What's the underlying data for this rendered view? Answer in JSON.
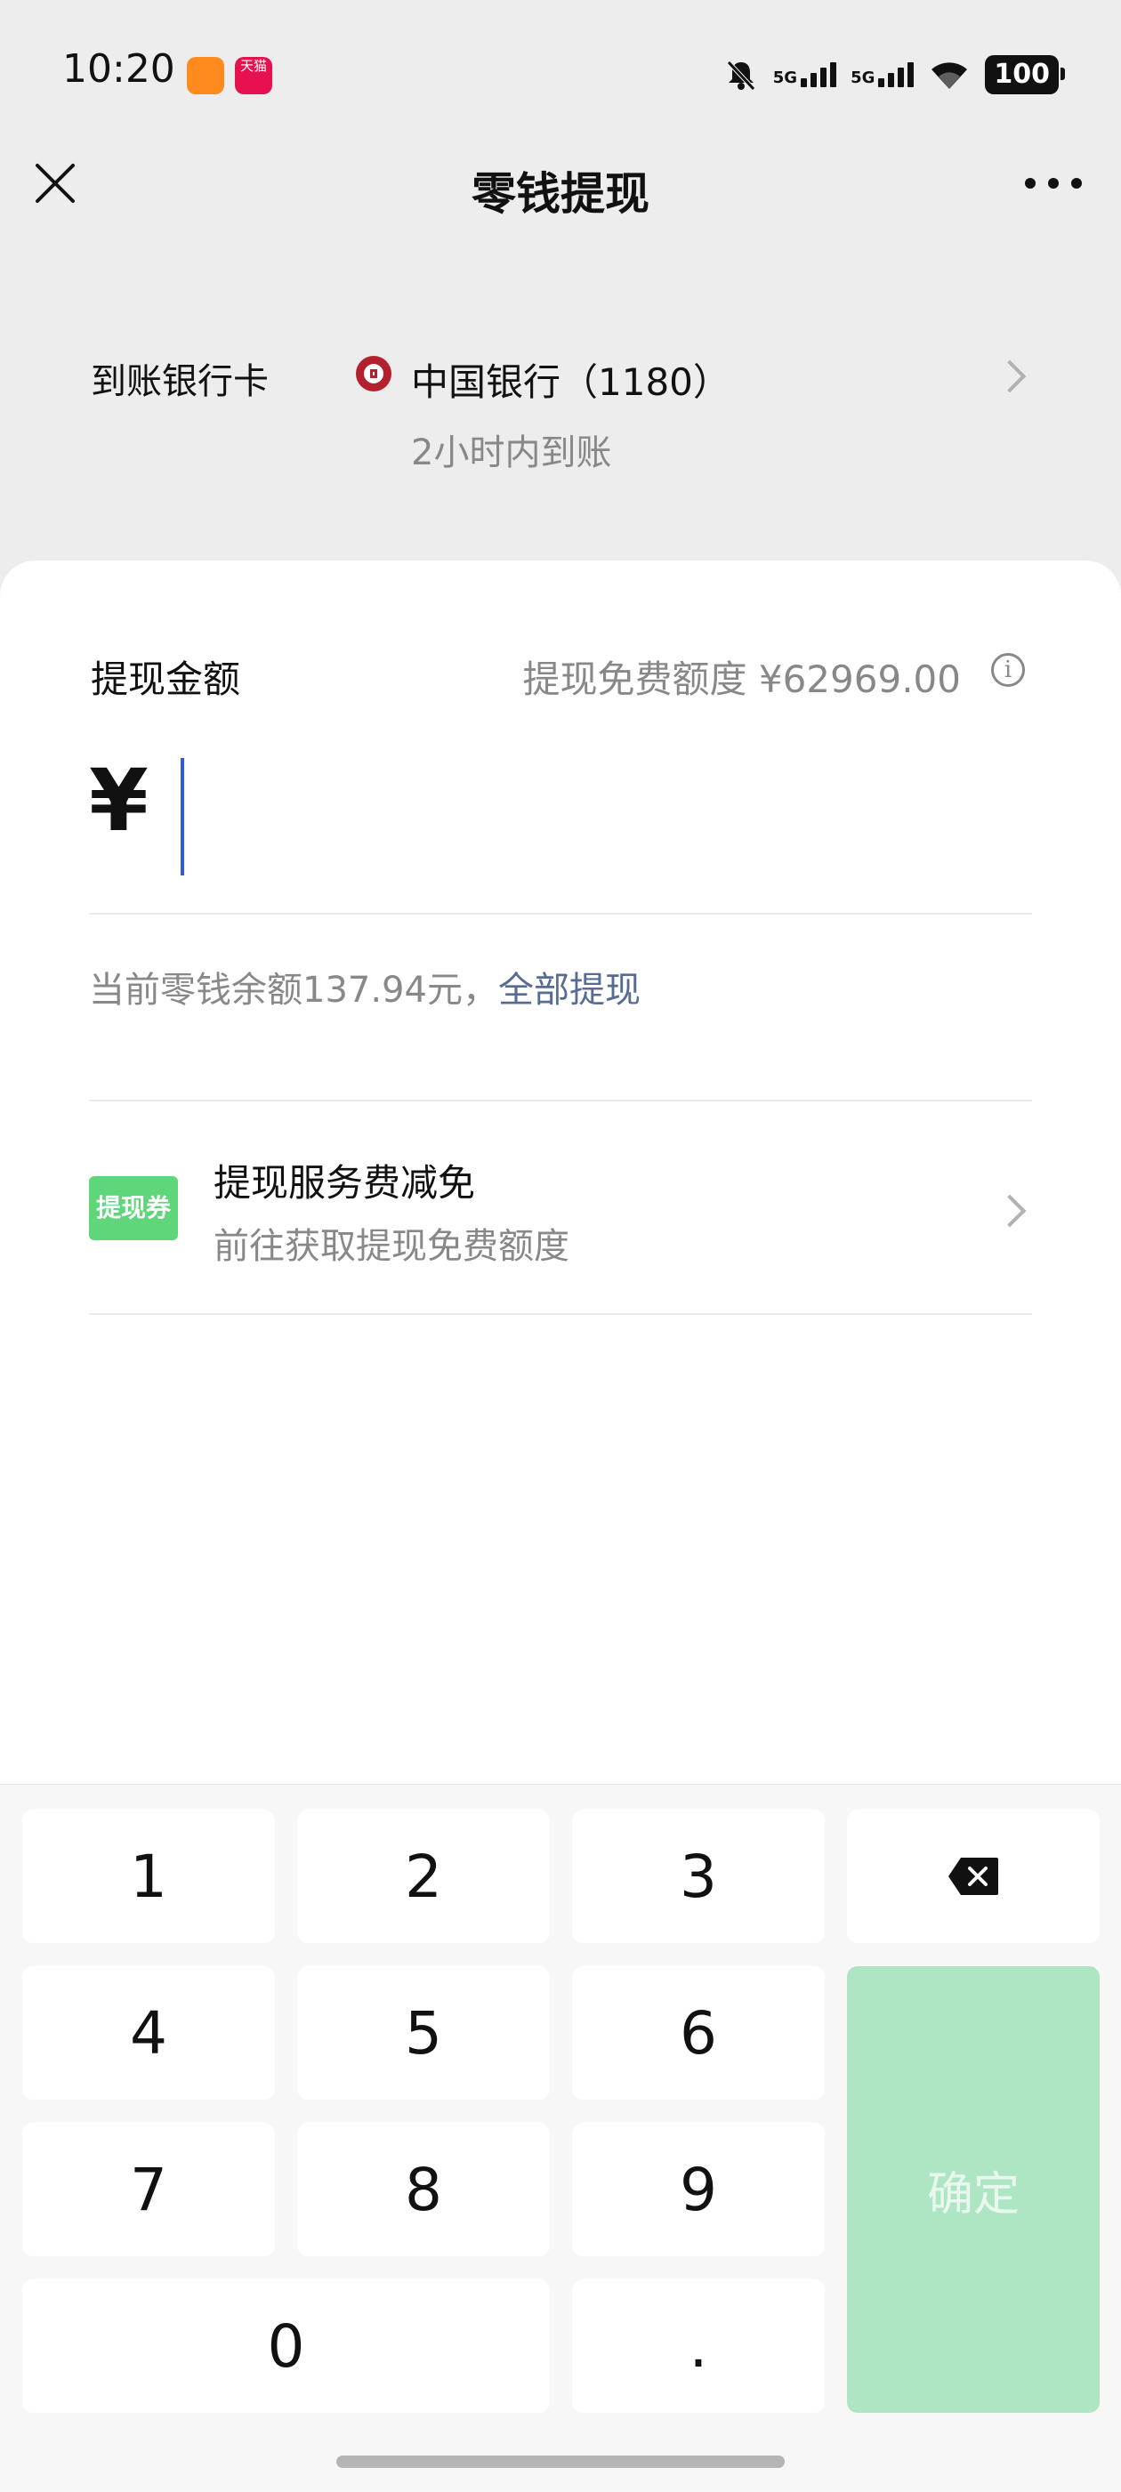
{
  "status_bar": {
    "time": "10:20",
    "tmall_label": "天猫",
    "network": [
      "5G",
      "5G"
    ],
    "battery": "100"
  },
  "nav": {
    "title": "零钱提现"
  },
  "bank": {
    "label": "到账银行卡",
    "name": "中国银行（1180）",
    "eta": "2小时内到账"
  },
  "amount": {
    "label": "提现金额",
    "quota": "提现免费额度 ¥62969.00",
    "currency": "¥",
    "value": ""
  },
  "balance": {
    "text": "当前零钱余额137.94元，",
    "withdraw_all": "全部提现"
  },
  "coupon": {
    "badge": "提现券",
    "title": "提现服务费减免",
    "subtitle": "前往获取提现免费额度"
  },
  "keypad": {
    "keys": [
      "1",
      "2",
      "3",
      "4",
      "5",
      "6",
      "7",
      "8",
      "9",
      "0",
      "."
    ],
    "confirm": "确定"
  },
  "colors": {
    "accent_link": "#576b95",
    "confirm_disabled": "#aee6c4",
    "coupon_green": "#5fd67a",
    "bank_red": "#b5202e"
  }
}
